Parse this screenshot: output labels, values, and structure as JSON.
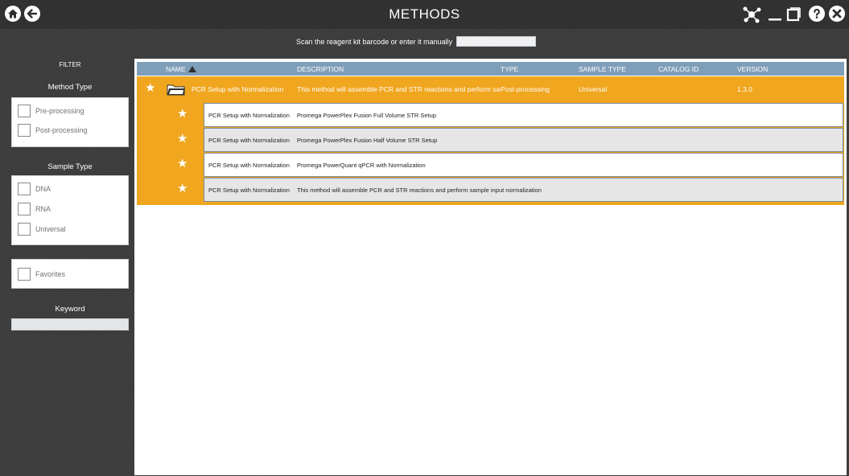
{
  "window": {
    "title": "METHODS"
  },
  "icons": {
    "home": "home-icon",
    "back": "back-arrow-icon",
    "network": "network-icon",
    "minimize": "minimize-icon",
    "maximize": "maximize-icon",
    "help": "help-icon",
    "close": "close-icon"
  },
  "scan": {
    "label": "Scan the reagent kit barcode or enter it manually",
    "value": ""
  },
  "filter": {
    "title": "FILTER",
    "method_type": {
      "title": "Method Type",
      "options": [
        "Pre-processing",
        "Post-processing"
      ]
    },
    "sample_type": {
      "title": "Sample Type",
      "options": [
        "DNA",
        "RNA",
        "Universal"
      ]
    },
    "favorites": {
      "label": "Favorites"
    },
    "keyword": {
      "title": "Keyword",
      "value": ""
    }
  },
  "table": {
    "columns": [
      "NAME",
      "DESCRIPTION",
      "TYPE",
      "SAMPLE TYPE",
      "CATALOG ID",
      "VERSION"
    ],
    "group": {
      "name": "PCR Setup with Normalization",
      "description": "This method will assemble PCR and STR reactions and perform sample i...",
      "type": "Post-processing",
      "sample_type": "Universal",
      "catalog_id": "",
      "version": "1.3.0"
    },
    "subrows": [
      {
        "name": "PCR Setup with Normalization",
        "description": "Promega PowerPlex Fusion Full Volume STR Setup"
      },
      {
        "name": "PCR Setup with Normalization",
        "description": "Promega PowerPlex Fusion Half Volume STR Setup"
      },
      {
        "name": "PCR Setup with Normalization",
        "description": "Promega PowerQuant qPCR with Normalization"
      },
      {
        "name": "PCR Setup with Normalization",
        "description": "This method will assemble PCR and STR reactions and perform sample input normalization"
      }
    ]
  },
  "colors": {
    "accent_orange": "#f0a61f",
    "header_blue": "#7f9eb9",
    "chrome_dark": "#3c3c3c"
  }
}
